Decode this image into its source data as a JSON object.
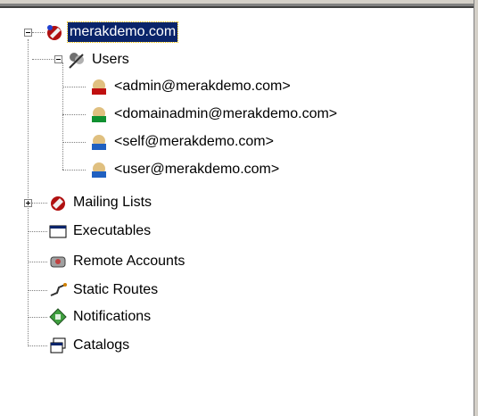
{
  "tree": {
    "root": {
      "label": "merakdemo.com",
      "icon": "domain-icon",
      "selected": true,
      "expanded": true
    },
    "users": {
      "label": "Users",
      "icon": "users-icon",
      "expanded": true,
      "items": [
        {
          "label": "<admin@merakdemo.com>",
          "icon": "admin-user-icon"
        },
        {
          "label": "<domainadmin@merakdemo.com>",
          "icon": "domain-admin-user-icon"
        },
        {
          "label": "<self@merakdemo.com>",
          "icon": "user-icon"
        },
        {
          "label": "<user@merakdemo.com>",
          "icon": "user-icon"
        }
      ]
    },
    "nodes": [
      {
        "label": "Mailing Lists",
        "icon": "mailing-lists-icon",
        "expandable": true
      },
      {
        "label": "Executables",
        "icon": "executables-icon"
      },
      {
        "label": "Remote Accounts",
        "icon": "remote-accounts-icon"
      },
      {
        "label": "Static Routes",
        "icon": "static-routes-icon"
      },
      {
        "label": "Notifications",
        "icon": "notifications-icon"
      },
      {
        "label": "Catalogs",
        "icon": "catalogs-icon"
      }
    ]
  }
}
